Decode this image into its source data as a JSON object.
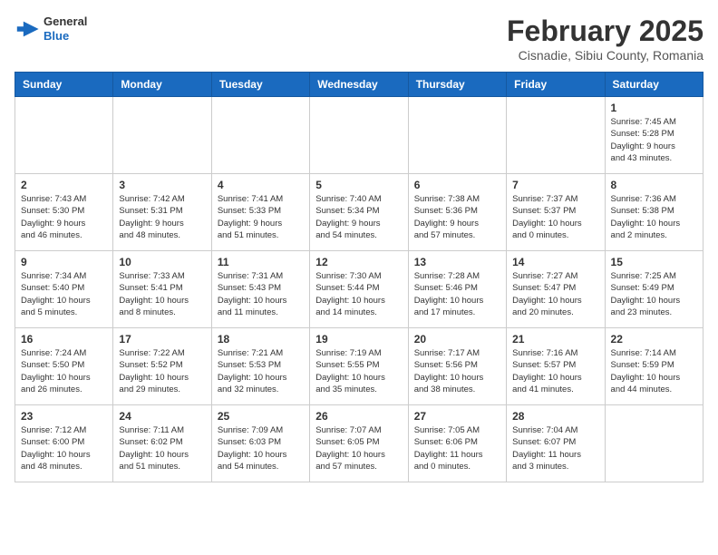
{
  "header": {
    "logo": {
      "general": "General",
      "blue": "Blue"
    },
    "title": "February 2025",
    "location": "Cisnadie, Sibiu County, Romania"
  },
  "weekdays": [
    "Sunday",
    "Monday",
    "Tuesday",
    "Wednesday",
    "Thursday",
    "Friday",
    "Saturday"
  ],
  "weeks": [
    [
      {
        "day": "",
        "info": ""
      },
      {
        "day": "",
        "info": ""
      },
      {
        "day": "",
        "info": ""
      },
      {
        "day": "",
        "info": ""
      },
      {
        "day": "",
        "info": ""
      },
      {
        "day": "",
        "info": ""
      },
      {
        "day": "1",
        "info": "Sunrise: 7:45 AM\nSunset: 5:28 PM\nDaylight: 9 hours\nand 43 minutes."
      }
    ],
    [
      {
        "day": "2",
        "info": "Sunrise: 7:43 AM\nSunset: 5:30 PM\nDaylight: 9 hours\nand 46 minutes."
      },
      {
        "day": "3",
        "info": "Sunrise: 7:42 AM\nSunset: 5:31 PM\nDaylight: 9 hours\nand 48 minutes."
      },
      {
        "day": "4",
        "info": "Sunrise: 7:41 AM\nSunset: 5:33 PM\nDaylight: 9 hours\nand 51 minutes."
      },
      {
        "day": "5",
        "info": "Sunrise: 7:40 AM\nSunset: 5:34 PM\nDaylight: 9 hours\nand 54 minutes."
      },
      {
        "day": "6",
        "info": "Sunrise: 7:38 AM\nSunset: 5:36 PM\nDaylight: 9 hours\nand 57 minutes."
      },
      {
        "day": "7",
        "info": "Sunrise: 7:37 AM\nSunset: 5:37 PM\nDaylight: 10 hours\nand 0 minutes."
      },
      {
        "day": "8",
        "info": "Sunrise: 7:36 AM\nSunset: 5:38 PM\nDaylight: 10 hours\nand 2 minutes."
      }
    ],
    [
      {
        "day": "9",
        "info": "Sunrise: 7:34 AM\nSunset: 5:40 PM\nDaylight: 10 hours\nand 5 minutes."
      },
      {
        "day": "10",
        "info": "Sunrise: 7:33 AM\nSunset: 5:41 PM\nDaylight: 10 hours\nand 8 minutes."
      },
      {
        "day": "11",
        "info": "Sunrise: 7:31 AM\nSunset: 5:43 PM\nDaylight: 10 hours\nand 11 minutes."
      },
      {
        "day": "12",
        "info": "Sunrise: 7:30 AM\nSunset: 5:44 PM\nDaylight: 10 hours\nand 14 minutes."
      },
      {
        "day": "13",
        "info": "Sunrise: 7:28 AM\nSunset: 5:46 PM\nDaylight: 10 hours\nand 17 minutes."
      },
      {
        "day": "14",
        "info": "Sunrise: 7:27 AM\nSunset: 5:47 PM\nDaylight: 10 hours\nand 20 minutes."
      },
      {
        "day": "15",
        "info": "Sunrise: 7:25 AM\nSunset: 5:49 PM\nDaylight: 10 hours\nand 23 minutes."
      }
    ],
    [
      {
        "day": "16",
        "info": "Sunrise: 7:24 AM\nSunset: 5:50 PM\nDaylight: 10 hours\nand 26 minutes."
      },
      {
        "day": "17",
        "info": "Sunrise: 7:22 AM\nSunset: 5:52 PM\nDaylight: 10 hours\nand 29 minutes."
      },
      {
        "day": "18",
        "info": "Sunrise: 7:21 AM\nSunset: 5:53 PM\nDaylight: 10 hours\nand 32 minutes."
      },
      {
        "day": "19",
        "info": "Sunrise: 7:19 AM\nSunset: 5:55 PM\nDaylight: 10 hours\nand 35 minutes."
      },
      {
        "day": "20",
        "info": "Sunrise: 7:17 AM\nSunset: 5:56 PM\nDaylight: 10 hours\nand 38 minutes."
      },
      {
        "day": "21",
        "info": "Sunrise: 7:16 AM\nSunset: 5:57 PM\nDaylight: 10 hours\nand 41 minutes."
      },
      {
        "day": "22",
        "info": "Sunrise: 7:14 AM\nSunset: 5:59 PM\nDaylight: 10 hours\nand 44 minutes."
      }
    ],
    [
      {
        "day": "23",
        "info": "Sunrise: 7:12 AM\nSunset: 6:00 PM\nDaylight: 10 hours\nand 48 minutes."
      },
      {
        "day": "24",
        "info": "Sunrise: 7:11 AM\nSunset: 6:02 PM\nDaylight: 10 hours\nand 51 minutes."
      },
      {
        "day": "25",
        "info": "Sunrise: 7:09 AM\nSunset: 6:03 PM\nDaylight: 10 hours\nand 54 minutes."
      },
      {
        "day": "26",
        "info": "Sunrise: 7:07 AM\nSunset: 6:05 PM\nDaylight: 10 hours\nand 57 minutes."
      },
      {
        "day": "27",
        "info": "Sunrise: 7:05 AM\nSunset: 6:06 PM\nDaylight: 11 hours\nand 0 minutes."
      },
      {
        "day": "28",
        "info": "Sunrise: 7:04 AM\nSunset: 6:07 PM\nDaylight: 11 hours\nand 3 minutes."
      },
      {
        "day": "",
        "info": ""
      }
    ]
  ]
}
